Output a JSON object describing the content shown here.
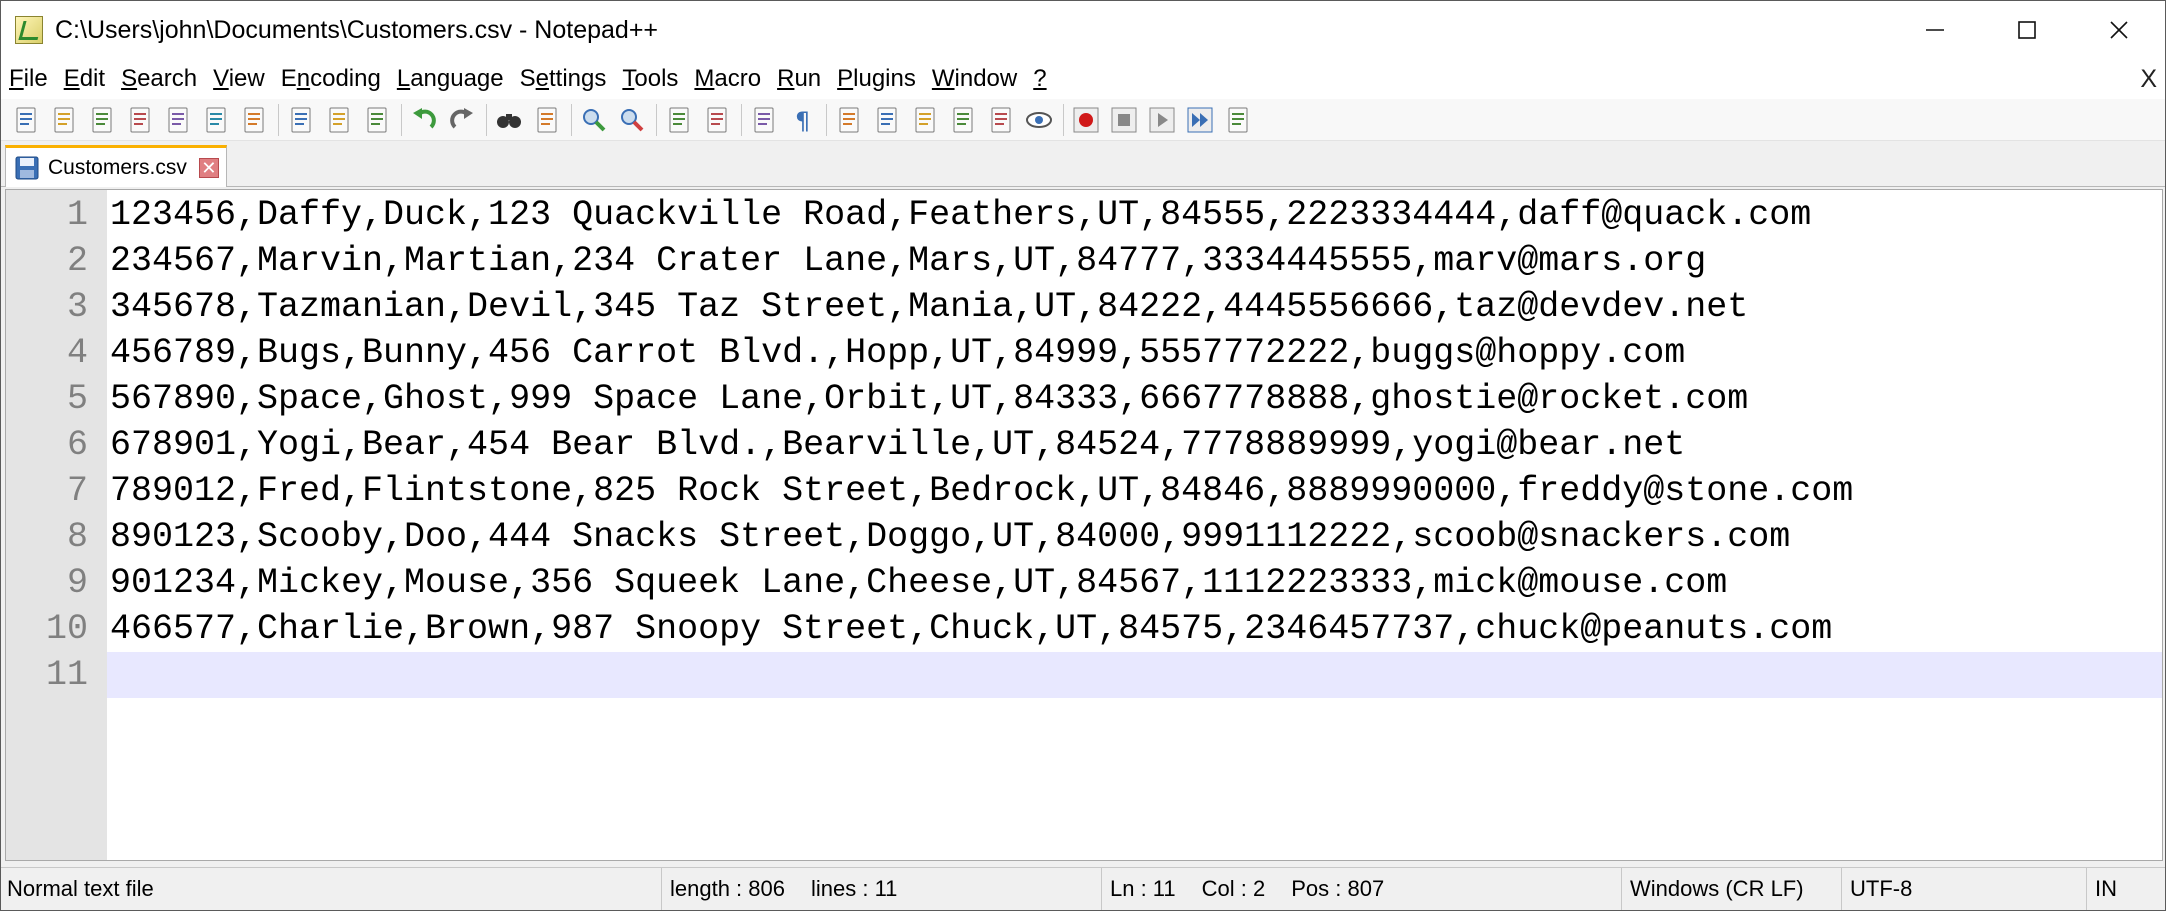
{
  "window": {
    "title": "C:\\Users\\john\\Documents\\Customers.csv - Notepad++",
    "controls": {
      "minimize": "—",
      "maximize": "☐",
      "close": "✕"
    }
  },
  "menu": {
    "items": [
      {
        "label": "File",
        "underline_index": 0
      },
      {
        "label": "Edit",
        "underline_index": 0
      },
      {
        "label": "Search",
        "underline_index": 0
      },
      {
        "label": "View",
        "underline_index": 0
      },
      {
        "label": "Encoding",
        "underline_index": 1
      },
      {
        "label": "Language",
        "underline_index": 0
      },
      {
        "label": "Settings",
        "underline_index": 1
      },
      {
        "label": "Tools",
        "underline_index": 0
      },
      {
        "label": "Macro",
        "underline_index": 0
      },
      {
        "label": "Run",
        "underline_index": 0
      },
      {
        "label": "Plugins",
        "underline_index": 0
      },
      {
        "label": "Window",
        "underline_index": 0
      },
      {
        "label": "?",
        "underline_index": 0
      }
    ],
    "close_label": "X"
  },
  "toolbar": {
    "groups": [
      [
        "new-file-icon",
        "open-file-icon",
        "save-icon",
        "save-all-icon",
        "close-icon",
        "close-all-icon",
        "print-icon"
      ],
      [
        "cut-icon",
        "copy-icon",
        "paste-icon"
      ],
      [
        "undo-icon",
        "redo-icon"
      ],
      [
        "find-icon",
        "replace-icon"
      ],
      [
        "zoom-in-icon",
        "zoom-out-icon"
      ],
      [
        "sync-vertical-icon",
        "sync-horizontal-icon"
      ],
      [
        "word-wrap-icon",
        "show-all-chars-icon"
      ],
      [
        "indent-guide-icon",
        "user-defined-language-icon",
        "document-map-icon",
        "function-list-icon",
        "folder-as-workspace-icon",
        "monitoring-icon"
      ],
      [
        "record-macro-icon",
        "stop-recording-icon",
        "playback-macro-icon",
        "run-macro-multiple-icon",
        "save-macro-icon"
      ]
    ]
  },
  "tabs": [
    {
      "label": "Customers.csv",
      "active": true,
      "close_label": "✕"
    }
  ],
  "editor": {
    "lines": [
      {
        "num": "1",
        "text": "123456,Daffy,Duck,123 Quackville Road,Feathers,UT,84555,2223334444,daff@quack.com"
      },
      {
        "num": "2",
        "text": "234567,Marvin,Martian,234 Crater Lane,Mars,UT,84777,3334445555,marv@mars.org"
      },
      {
        "num": "3",
        "text": "345678,Tazmanian,Devil,345 Taz Street,Mania,UT,84222,4445556666,taz@devdev.net"
      },
      {
        "num": "4",
        "text": "456789,Bugs,Bunny,456 Carrot Blvd.,Hopp,UT,84999,5557772222,buggs@hoppy.com"
      },
      {
        "num": "5",
        "text": "567890,Space,Ghost,999 Space Lane,Orbit,UT,84333,6667778888,ghostie@rocket.com"
      },
      {
        "num": "6",
        "text": "678901,Yogi,Bear,454 Bear Blvd.,Bearville,UT,84524,7778889999,yogi@bear.net"
      },
      {
        "num": "7",
        "text": "789012,Fred,Flintstone,825 Rock Street,Bedrock,UT,84846,8889990000,freddy@stone.com"
      },
      {
        "num": "8",
        "text": "890123,Scooby,Doo,444 Snacks Street,Doggo,UT,84000,9991112222,scoob@snackers.com"
      },
      {
        "num": "9",
        "text": "901234,Mickey,Mouse,356 Squeek Lane,Cheese,UT,84567,1112223333,mick@mouse.com"
      },
      {
        "num": "10",
        "text": "466577,Charlie,Brown,987 Snoopy Street,Chuck,UT,84575,2346457737,chuck@peanuts.com"
      },
      {
        "num": "11",
        "text": ""
      }
    ],
    "current_line": 11
  },
  "status": {
    "file_type": "Normal text file",
    "length": "length : 806",
    "lines": "lines : 11",
    "ln": "Ln : 11",
    "col": "Col : 2",
    "pos": "Pos : 807",
    "eol": "Windows (CR LF)",
    "encoding": "UTF-8",
    "mode": "IN"
  },
  "colors": {
    "current_line": "#e8e8ff",
    "gutter": "#e4e4e4",
    "tab_accent": "#fab000"
  }
}
